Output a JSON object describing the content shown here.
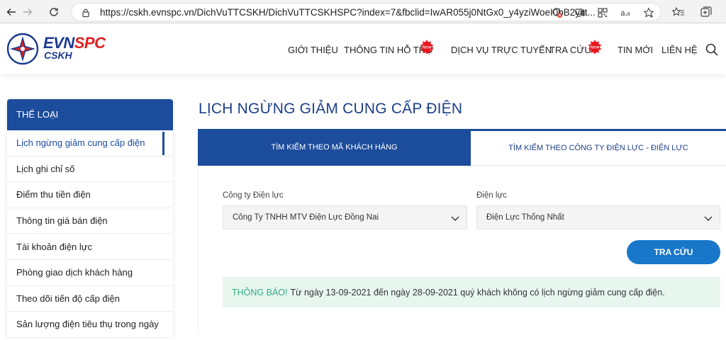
{
  "browser": {
    "url": "https://cskh.evnspc.vn/DichVuTTCSKH/DichVuTTCSKHSPC?index=7&fbclid=IwAR055j0NtGx0_y4yziWoeI0bB2yitt..."
  },
  "header": {
    "logo_main": "EVN",
    "logo_accent": "SPC",
    "logo_sub": "CSKH",
    "menu": [
      {
        "label": "GIỚI THIỆU"
      },
      {
        "label": "THÔNG TIN HỖ TRỢ",
        "badge": "New"
      },
      {
        "label": "DỊCH VỤ TRỰC TUYẾN"
      },
      {
        "label": "TRA CỨU",
        "badge": "New"
      },
      {
        "label": "TIN MỚI"
      },
      {
        "label": "LIÊN HỆ"
      }
    ]
  },
  "sidebar": {
    "title": "THỂ LOẠI",
    "items": [
      {
        "label": "Lịch ngừng giảm cung cấp điện",
        "active": true
      },
      {
        "label": "Lịch ghi chỉ số"
      },
      {
        "label": "Điểm thu tiền điện"
      },
      {
        "label": "Thông tin giá bán điện"
      },
      {
        "label": "Tài khoản điện lực"
      },
      {
        "label": "Phòng giao dịch khách hàng"
      },
      {
        "label": "Theo dõi tiến độ cấp điện"
      },
      {
        "label": "Sản lượng điện tiêu thụ trong ngày"
      }
    ]
  },
  "main": {
    "title": "LỊCH NGỪNG GIẢM CUNG CẤP ĐIỆN",
    "tabs": [
      {
        "label": "TÌM KIẾM THEO MÃ KHÁCH HÀNG",
        "active": true
      },
      {
        "label": "TÌM KIẾM THEO CÔNG TY ĐIỆN LỰC - ĐIỆN LỰC",
        "active": false
      }
    ],
    "company_label": "Công ty Điện lực",
    "company_value": "Công Ty TNHH MTV Điện Lực Đồng Nai",
    "branch_label": "Điện lực",
    "branch_value": "Điện Lực Thống Nhất",
    "search_label": "TRA CỨU",
    "notice_lead": "THÔNG BÁO!",
    "notice_text": "Từ ngày 13-09-2021 đến ngày 28-09-2021 quý khách không có lịch ngừng giảm cung cấp điện."
  },
  "colors": {
    "primary": "#1c4c9c",
    "button": "#1877c9",
    "notice_bg": "#e8f6f0",
    "notice_lead": "#2fae7a",
    "logo_red": "#e02020"
  }
}
